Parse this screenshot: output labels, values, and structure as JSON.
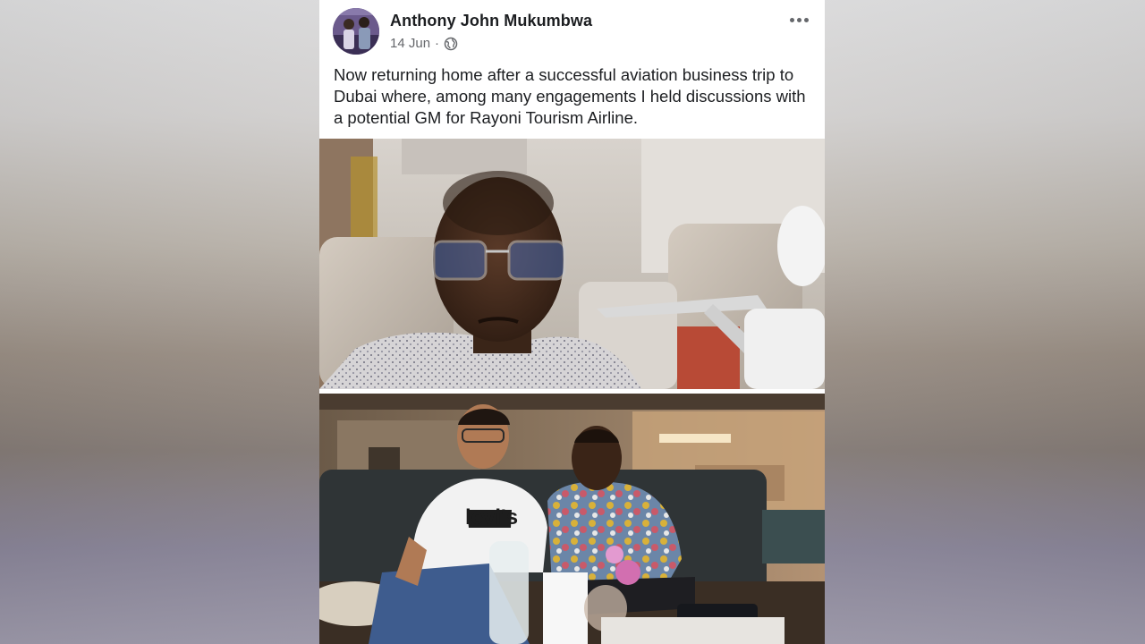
{
  "post": {
    "author_name": "Anthony John Mukumbwa",
    "date": "14 Jun",
    "separator": "·",
    "privacy_icon": "globe-icon",
    "more_icon": "more-options-icon",
    "text": "Now returning home after a successful aviation business trip to Dubai where, among many engagements I held discussions with a potential GM for Rayoni Tourism Airline.",
    "photos": [
      {
        "subject": "selfie-in-airplane-seat"
      },
      {
        "subject": "two-men-seated-in-lounge",
        "shirt_text": "levi's"
      }
    ]
  },
  "colors": {
    "author": "#1c1e21",
    "meta": "#65676b",
    "card_bg": "#ffffff"
  }
}
